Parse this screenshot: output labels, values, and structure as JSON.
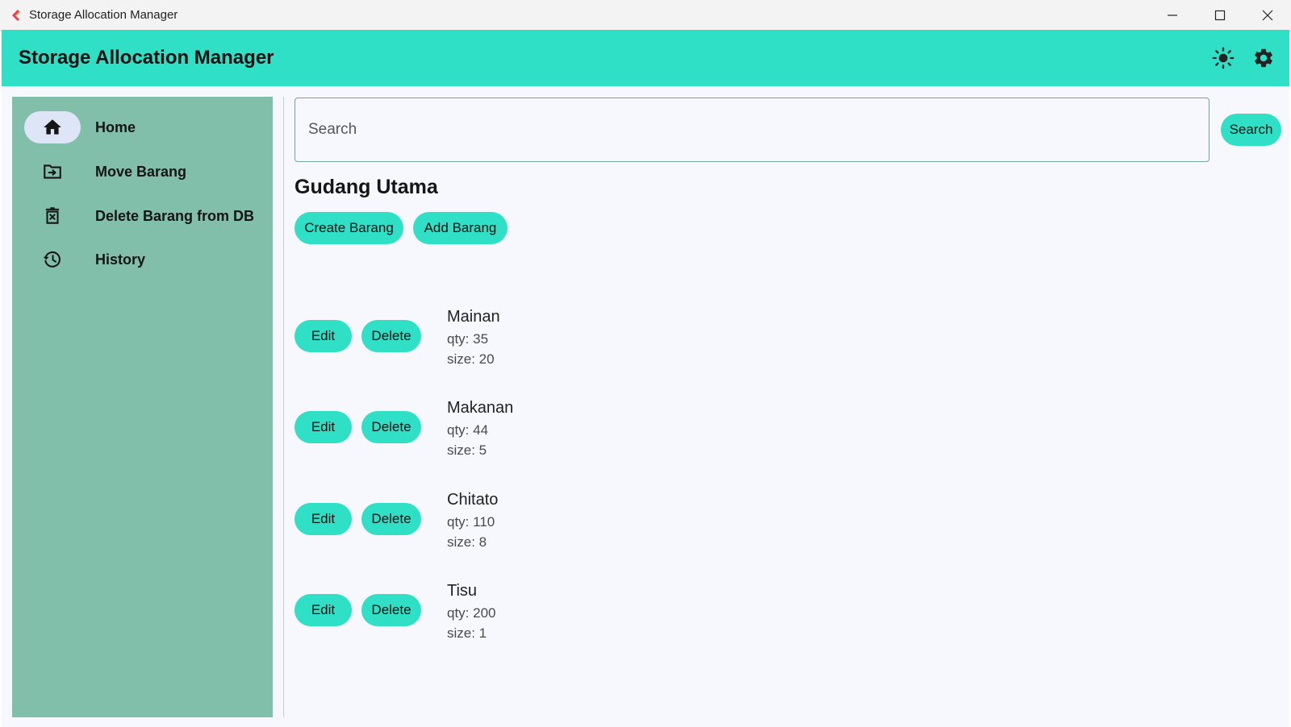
{
  "window": {
    "title": "Storage Allocation Manager"
  },
  "appbar": {
    "title": "Storage Allocation Manager",
    "actions": [
      {
        "icon": "brightness-icon"
      },
      {
        "icon": "gear-icon"
      }
    ]
  },
  "sidebar": {
    "items": [
      {
        "label": "Home",
        "icon": "home-icon",
        "active": true
      },
      {
        "label": "Move Barang",
        "icon": "folder-move-icon",
        "active": false
      },
      {
        "label": "Delete Barang from DB",
        "icon": "delete-icon",
        "active": false
      },
      {
        "label": "History",
        "icon": "history-icon",
        "active": false
      }
    ]
  },
  "search": {
    "placeholder": "Search",
    "value": "",
    "button_label": "Search"
  },
  "main": {
    "title": "Gudang Utama",
    "create_label": "Create Barang",
    "add_label": "Add Barang",
    "edit_label": "Edit",
    "delete_label": "Delete",
    "items": [
      {
        "name": "Mainan",
        "qty": "qty: 35",
        "size": "size: 20"
      },
      {
        "name": "Makanan",
        "qty": "qty: 44",
        "size": "size: 5"
      },
      {
        "name": "Chitato",
        "qty": "qty: 110",
        "size": "size: 8"
      },
      {
        "name": "Tisu",
        "qty": "qty: 200",
        "size": "size: 1"
      }
    ]
  },
  "colors": {
    "accent": "#2fe0c6",
    "sidebar": "#82bfaa",
    "background": "#f6f8fd",
    "active_pill": "#dde5f6"
  }
}
